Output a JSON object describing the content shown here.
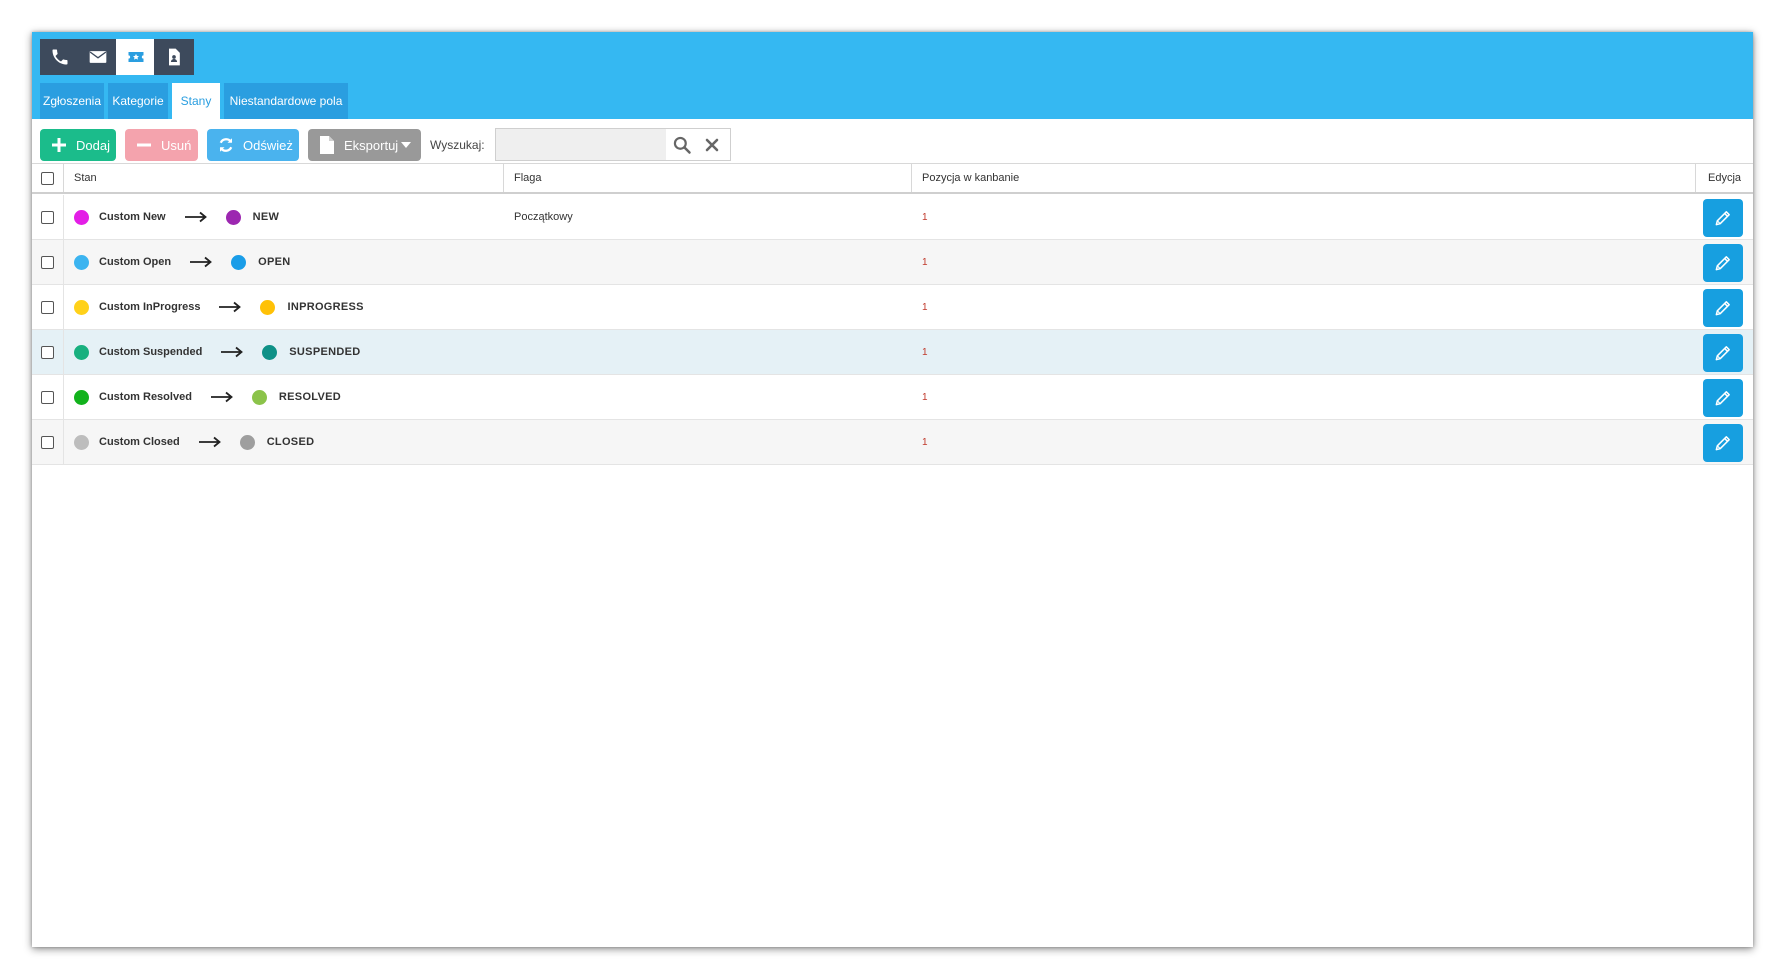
{
  "top_icons": [
    {
      "name": "phone-icon",
      "active": false
    },
    {
      "name": "envelope-icon",
      "active": false
    },
    {
      "name": "ticket-icon",
      "active": true
    },
    {
      "name": "contact-card-icon",
      "active": false
    }
  ],
  "tabs": [
    {
      "label": "Zgłoszenia",
      "active": false
    },
    {
      "label": "Kategorie",
      "active": false
    },
    {
      "label": "Stany",
      "active": true
    },
    {
      "label": "Niestandardowe pola",
      "active": false
    }
  ],
  "toolbar": {
    "add_label": "Dodaj",
    "remove_label": "Usuń",
    "refresh_label": "Odśwież",
    "export_label": "Eksportuj",
    "search_label": "Wyszukaj:",
    "search_value": ""
  },
  "columns": {
    "stan": "Stan",
    "flaga": "Flaga",
    "pozycja": "Pozycja w kanbanie",
    "edycja": "Edycja"
  },
  "rows": [
    {
      "custom_name": "Custom New",
      "custom_color": "#e31ee6",
      "system_name": "NEW",
      "system_color": "#9c27b0",
      "flag": "Początkowy",
      "position": "1",
      "highlight": false
    },
    {
      "custom_name": "Custom Open",
      "custom_color": "#3cb4f0",
      "system_name": "OPEN",
      "system_color": "#1a9de8",
      "flag": "",
      "position": "1",
      "highlight": false
    },
    {
      "custom_name": "Custom InProgress",
      "custom_color": "#ffd11a",
      "system_name": "INPROGRESS",
      "system_color": "#ffc107",
      "flag": "",
      "position": "1",
      "highlight": false
    },
    {
      "custom_name": "Custom Suspended",
      "custom_color": "#18b07f",
      "system_name": "SUSPENDED",
      "system_color": "#0e9187",
      "flag": "",
      "position": "1",
      "highlight": true
    },
    {
      "custom_name": "Custom Resolved",
      "custom_color": "#12b21c",
      "system_name": "RESOLVED",
      "system_color": "#8bc34a",
      "flag": "",
      "position": "1",
      "highlight": false
    },
    {
      "custom_name": "Custom Closed",
      "custom_color": "#bdbdbd",
      "system_name": "CLOSED",
      "system_color": "#9e9e9e",
      "flag": "",
      "position": "1",
      "highlight": false
    }
  ],
  "colors": {
    "topbar": "#35b8f2",
    "tab": "#2a9ee0",
    "icon_tab": "#3d4a5c",
    "add": "#1bbc8b",
    "remove": "#f4a3ad",
    "refresh": "#4ab3ee",
    "export": "#999999",
    "edit": "#179fe0"
  }
}
